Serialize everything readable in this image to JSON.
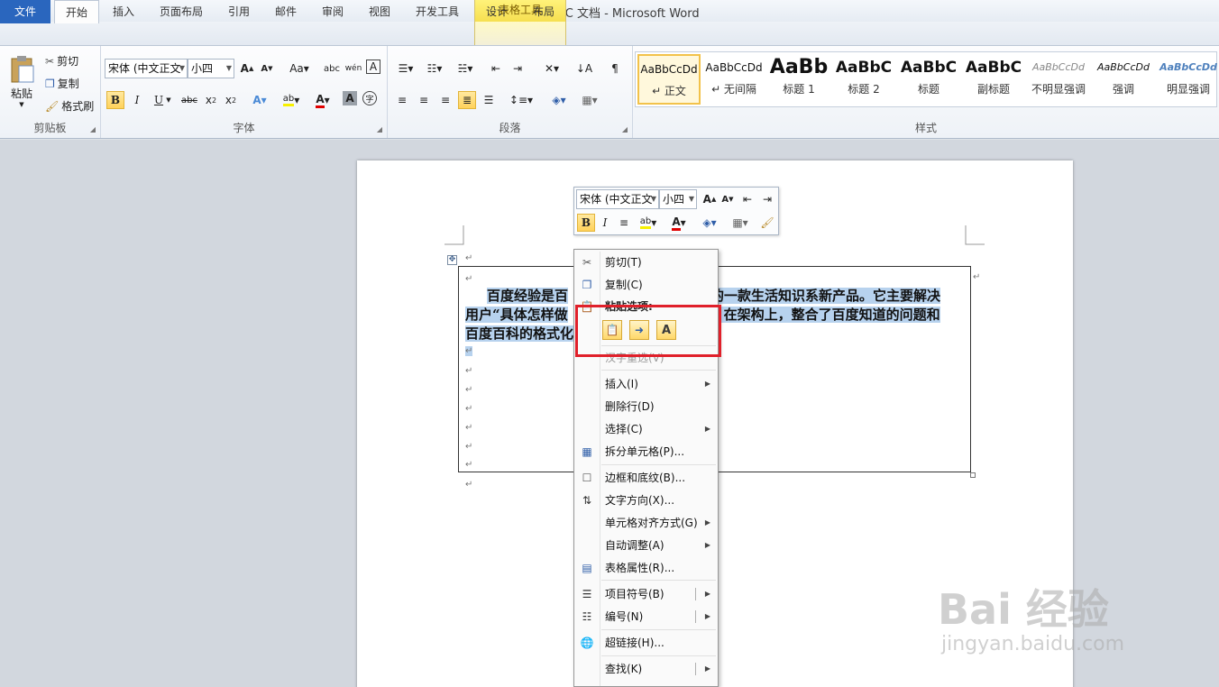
{
  "window": {
    "title": "新建 DOC 文档 - Microsoft Word",
    "context_tab_group": "表格工具"
  },
  "quick_access": {
    "app_icon": "W",
    "save_icon": "save-icon",
    "undo_icon": "undo-icon",
    "redo_icon": "redo-icon"
  },
  "tabs": [
    "文件",
    "开始",
    "插入",
    "页面布局",
    "引用",
    "邮件",
    "审阅",
    "视图",
    "开发工具",
    "设计",
    "布局"
  ],
  "ribbon": {
    "clipboard": {
      "paste": "粘贴",
      "cut": "剪切",
      "copy": "复制",
      "format_painter": "格式刷",
      "label": "剪贴板"
    },
    "font": {
      "font_name": "宋体 (中文正文",
      "font_size": "小四",
      "label": "字体"
    },
    "paragraph": {
      "label": "段落"
    },
    "styles": {
      "label": "样式",
      "items": [
        {
          "preview": "AaBbCcDd",
          "name": "↵ 正文"
        },
        {
          "preview": "AaBbCcDd",
          "name": "↵ 无间隔"
        },
        {
          "preview": "AaBb",
          "name": "标题 1"
        },
        {
          "preview": "AaBbC",
          "name": "标题 2"
        },
        {
          "preview": "AaBbC",
          "name": "标题"
        },
        {
          "preview": "AaBbC",
          "name": "副标题"
        },
        {
          "preview": "AaBbCcDd",
          "name": "不明显强调"
        },
        {
          "preview": "AaBbCcDd",
          "name": "强调"
        },
        {
          "preview": "AaBbCcDd",
          "name": "明显强调"
        }
      ]
    }
  },
  "document": {
    "line1_a": "百度经验是百",
    "line1_b": "的一款生活知识系新产品。它主要解决",
    "line2_a": "用户“具体怎样做",
    "line2_b": "，在架构上，整合了百度知道的问题和",
    "line3": "百度百科的格式化"
  },
  "mini_toolbar": {
    "font_name": "宋体 (中文正文",
    "font_size": "小四"
  },
  "context_menu": {
    "items": [
      {
        "label": "剪切(T)",
        "icon": "scissors-icon"
      },
      {
        "label": "复制(C)",
        "icon": "copy-icon"
      },
      {
        "label": "粘贴选项:",
        "icon": "paste-icon"
      },
      {
        "label": "汉字重选(V)"
      },
      {
        "label": "插入(I)"
      },
      {
        "label": "删除行(D)"
      },
      {
        "label": "选择(C)"
      },
      {
        "label": "拆分单元格(P)...",
        "icon": "split-cells-icon"
      },
      {
        "label": "边框和底纹(B)...",
        "icon": "borders-icon"
      },
      {
        "label": "文字方向(X)...",
        "icon": "text-direction-icon"
      },
      {
        "label": "单元格对齐方式(G)"
      },
      {
        "label": "自动调整(A)"
      },
      {
        "label": "表格属性(R)...",
        "icon": "table-properties-icon"
      },
      {
        "label": "项目符号(B)",
        "icon": "bullets-icon"
      },
      {
        "label": "编号(N)",
        "icon": "numbering-icon"
      },
      {
        "label": "超链接(H)...",
        "icon": "hyperlink-icon"
      },
      {
        "label": "查找(K)"
      }
    ],
    "paste_text_only": "A"
  },
  "watermark": {
    "brand": "Bai 经验",
    "url": "jingyan.baidu.com"
  }
}
